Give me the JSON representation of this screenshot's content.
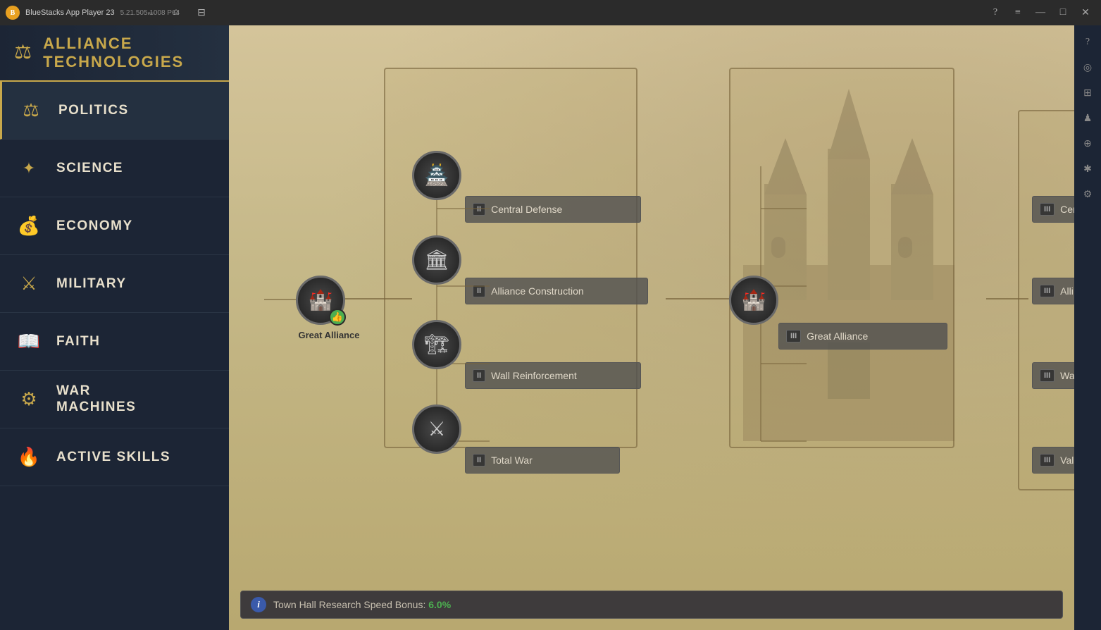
{
  "titleBar": {
    "appName": "BlueStacks App Player 23",
    "version": "5.21.505.1008  P64",
    "navBack": "←",
    "navHome": "⌂",
    "navBookmark": "🔖",
    "controls": {
      "help": "?",
      "menu": "≡",
      "minimize": "—",
      "maximize": "□",
      "close": "✕"
    }
  },
  "header": {
    "title": "ALLIANCE TECHNOLOGIES",
    "icon": "⚖"
  },
  "sidebar": {
    "items": [
      {
        "id": "politics",
        "label": "POLITICS",
        "icon": "⚖",
        "active": true
      },
      {
        "id": "science",
        "label": "SCIENCE",
        "icon": "✕"
      },
      {
        "id": "economy",
        "label": "ECONOMY",
        "icon": "⊙"
      },
      {
        "id": "military",
        "label": "MILITARY",
        "icon": "✕"
      },
      {
        "id": "faith",
        "label": "FAITH",
        "icon": "📖"
      },
      {
        "id": "war-machines",
        "label": "WAR\nMACHINES",
        "icon": "⚙"
      },
      {
        "id": "active-skills",
        "label": "ACTIVE SKILLS",
        "icon": "🔥"
      }
    ]
  },
  "techTree": {
    "tierI": {
      "node": {
        "label": "Great Alliance",
        "hasThumb": true
      }
    },
    "tierII": {
      "label": "II",
      "nodes": [
        {
          "id": "central-defense-top",
          "label": "Central Defense",
          "tier": "II",
          "position": "top"
        },
        {
          "id": "alliance-construction",
          "label": "Alliance Construction",
          "tier": "II",
          "position": "mid-top"
        },
        {
          "id": "wall-reinforcement",
          "label": "Wall Reinforcement",
          "tier": "II",
          "position": "mid-bot"
        },
        {
          "id": "total-war",
          "label": "Total War",
          "tier": "II",
          "position": "bot"
        }
      ]
    },
    "tierIII": {
      "nodes": [
        {
          "id": "great-alliance-3",
          "label": "Great Alliance",
          "tier": "III"
        }
      ]
    },
    "tierIV": {
      "nodes": [
        {
          "id": "cen-partial",
          "label": "Cen",
          "tier": "III",
          "partial": true
        },
        {
          "id": "alli-partial",
          "label": "Alli",
          "tier": "III",
          "partial": true
        },
        {
          "id": "wal-partial",
          "label": "Wal",
          "tier": "III",
          "partial": true
        },
        {
          "id": "val-partial",
          "label": "Val",
          "tier": "III",
          "partial": true
        }
      ]
    }
  },
  "infoBar": {
    "text": "Town Hall Research Speed Bonus:",
    "value": "6.0%"
  },
  "rightSidebar": {
    "icons": [
      "?",
      "◎",
      "⊞",
      "♟",
      "⊕",
      "✱",
      "⚙"
    ]
  }
}
